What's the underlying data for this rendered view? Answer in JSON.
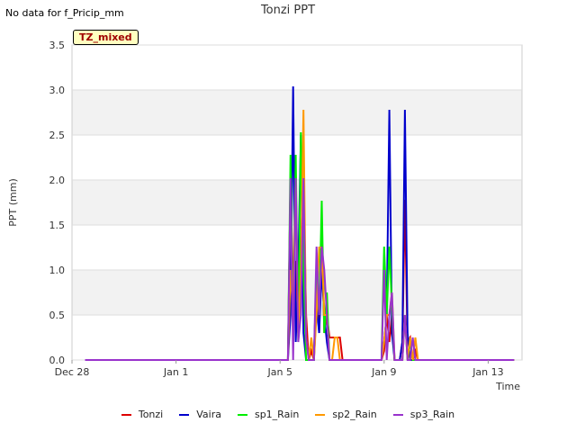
{
  "page": {
    "corner_note": "No data for f_Pricip_mm",
    "badge": "TZ_mixed"
  },
  "chart_data": {
    "type": "line",
    "title": "Tonzi PPT",
    "xlabel": "Time",
    "ylabel": "PPT (mm)",
    "ylim": [
      0,
      3.5
    ],
    "yticks": [
      "0.0",
      "0.5",
      "1.0",
      "1.5",
      "2.0",
      "2.5",
      "3.0",
      "3.5"
    ],
    "xlim": [
      0,
      17.3
    ],
    "xticks": [
      {
        "label": "Dec 28",
        "x": 0
      },
      {
        "label": "Jan 1",
        "x": 4
      },
      {
        "label": "Jan 5",
        "x": 8
      },
      {
        "label": "Jan 9",
        "x": 12
      },
      {
        "label": "Jan 13",
        "x": 16
      }
    ],
    "grid": true,
    "legend_position": "bottom",
    "series": [
      {
        "name": "Tonzi",
        "color": "#dd0000",
        "x": [
          0.5,
          8.3,
          8.4,
          8.5,
          8.6,
          8.7,
          8.8,
          8.9,
          9.0,
          9.1,
          9.2,
          9.3,
          9.4,
          9.5,
          9.6,
          9.7,
          9.8,
          9.9,
          10.0,
          10.1,
          10.2,
          10.3,
          10.4,
          11.9,
          12.0,
          12.1,
          12.2,
          12.3,
          12.4,
          12.6,
          12.7,
          12.8,
          12.9,
          13.0,
          13.1,
          13.2,
          13.3,
          17.0
        ],
        "y": [
          0,
          0,
          2.0,
          0.8,
          1.1,
          0.3,
          1.3,
          2.0,
          0.5,
          0.0,
          0.1,
          0.0,
          1.0,
          0.3,
          1.5,
          0.3,
          0.5,
          0.25,
          0.25,
          0.25,
          0.25,
          0.25,
          0,
          0,
          0.1,
          0.5,
          0.2,
          0.5,
          0.0,
          0,
          0.2,
          1.78,
          0.2,
          0.25,
          0.0,
          0.1,
          0,
          0
        ]
      },
      {
        "name": "Vaira",
        "color": "#0000cc",
        "x": [
          0.5,
          8.3,
          8.4,
          8.5,
          8.6,
          8.7,
          8.8,
          8.9,
          9.0,
          9.1,
          9.2,
          9.3,
          9.4,
          9.5,
          9.6,
          9.7,
          9.8,
          9.9,
          10.0,
          11.9,
          12.0,
          12.1,
          12.2,
          12.3,
          12.4,
          12.6,
          12.7,
          12.8,
          12.9,
          13.0,
          13.1,
          13.2,
          13.3,
          17.0
        ],
        "y": [
          0,
          0,
          0.5,
          3.04,
          0.2,
          1.0,
          2.5,
          0.3,
          0.0,
          0.0,
          0.0,
          0.0,
          0.6,
          0.3,
          1.0,
          0.5,
          0.2,
          0.0,
          0,
          0,
          0.2,
          0.5,
          2.78,
          0.3,
          0.0,
          0,
          0.2,
          2.78,
          0.3,
          0.0,
          0.0,
          0.0,
          0,
          0
        ]
      },
      {
        "name": "sp1_Rain",
        "color": "#00ee00",
        "x": [
          0.5,
          8.3,
          8.4,
          8.5,
          8.6,
          8.7,
          8.8,
          8.9,
          9.0,
          9.1,
          9.2,
          9.3,
          9.4,
          9.5,
          9.6,
          9.7,
          9.8,
          9.9,
          10.0,
          11.9,
          12.0,
          12.1,
          12.2,
          12.3,
          12.4,
          12.6,
          12.7,
          12.8,
          12.9,
          13.0,
          13.1,
          13.2,
          13.3,
          17.0
        ],
        "y": [
          0,
          0,
          2.28,
          0.2,
          2.28,
          0.2,
          2.53,
          1.0,
          0.0,
          0.0,
          0.0,
          0.0,
          1.0,
          0.5,
          1.77,
          0.3,
          0.75,
          0.0,
          0,
          0,
          1.26,
          0.5,
          1.26,
          0.6,
          0.0,
          0,
          0.0,
          0.5,
          0.0,
          0.2,
          0.0,
          0.0,
          0,
          0
        ]
      },
      {
        "name": "sp2_Rain",
        "color": "#ff9900",
        "x": [
          0.5,
          8.3,
          8.4,
          8.5,
          8.6,
          8.7,
          8.8,
          8.9,
          9.0,
          9.1,
          9.2,
          9.3,
          9.4,
          9.5,
          9.6,
          9.7,
          9.8,
          9.9,
          10.0,
          10.1,
          10.2,
          10.3,
          11.9,
          12.0,
          12.1,
          12.2,
          12.3,
          12.4,
          12.6,
          12.7,
          12.8,
          12.9,
          13.0,
          13.1,
          13.2,
          13.3,
          17.0
        ],
        "y": [
          0,
          0,
          1.0,
          0.5,
          2.0,
          0.3,
          1.0,
          2.78,
          0.25,
          0.0,
          0.25,
          0.0,
          0.5,
          1.25,
          1.25,
          0.5,
          0.5,
          0.0,
          0.0,
          0.25,
          0.25,
          0.0,
          0,
          0.2,
          0.5,
          0.5,
          0.75,
          0.0,
          0,
          0.0,
          0.5,
          0.0,
          0.25,
          0.0,
          0.25,
          0,
          0
        ]
      },
      {
        "name": "sp3_Rain",
        "color": "#9933cc",
        "x": [
          0.5,
          8.3,
          8.4,
          8.5,
          8.6,
          8.7,
          8.8,
          8.9,
          9.0,
          9.1,
          9.2,
          9.3,
          9.4,
          9.5,
          9.6,
          9.7,
          9.8,
          9.9,
          10.0,
          11.9,
          12.0,
          12.1,
          12.2,
          12.3,
          12.4,
          12.6,
          12.7,
          12.8,
          12.9,
          13.0,
          13.1,
          13.2,
          13.3,
          17.0
        ],
        "y": [
          0,
          0,
          2.02,
          0.0,
          2.02,
          0.2,
          0.5,
          2.02,
          0.25,
          0.0,
          0.0,
          0.0,
          1.26,
          0.5,
          1.26,
          1.0,
          0.5,
          0.0,
          0,
          0,
          1.0,
          0.0,
          0.5,
          0.75,
          0.0,
          0,
          0.0,
          0.5,
          0.0,
          0.0,
          0.25,
          0.0,
          0,
          0
        ]
      }
    ]
  }
}
